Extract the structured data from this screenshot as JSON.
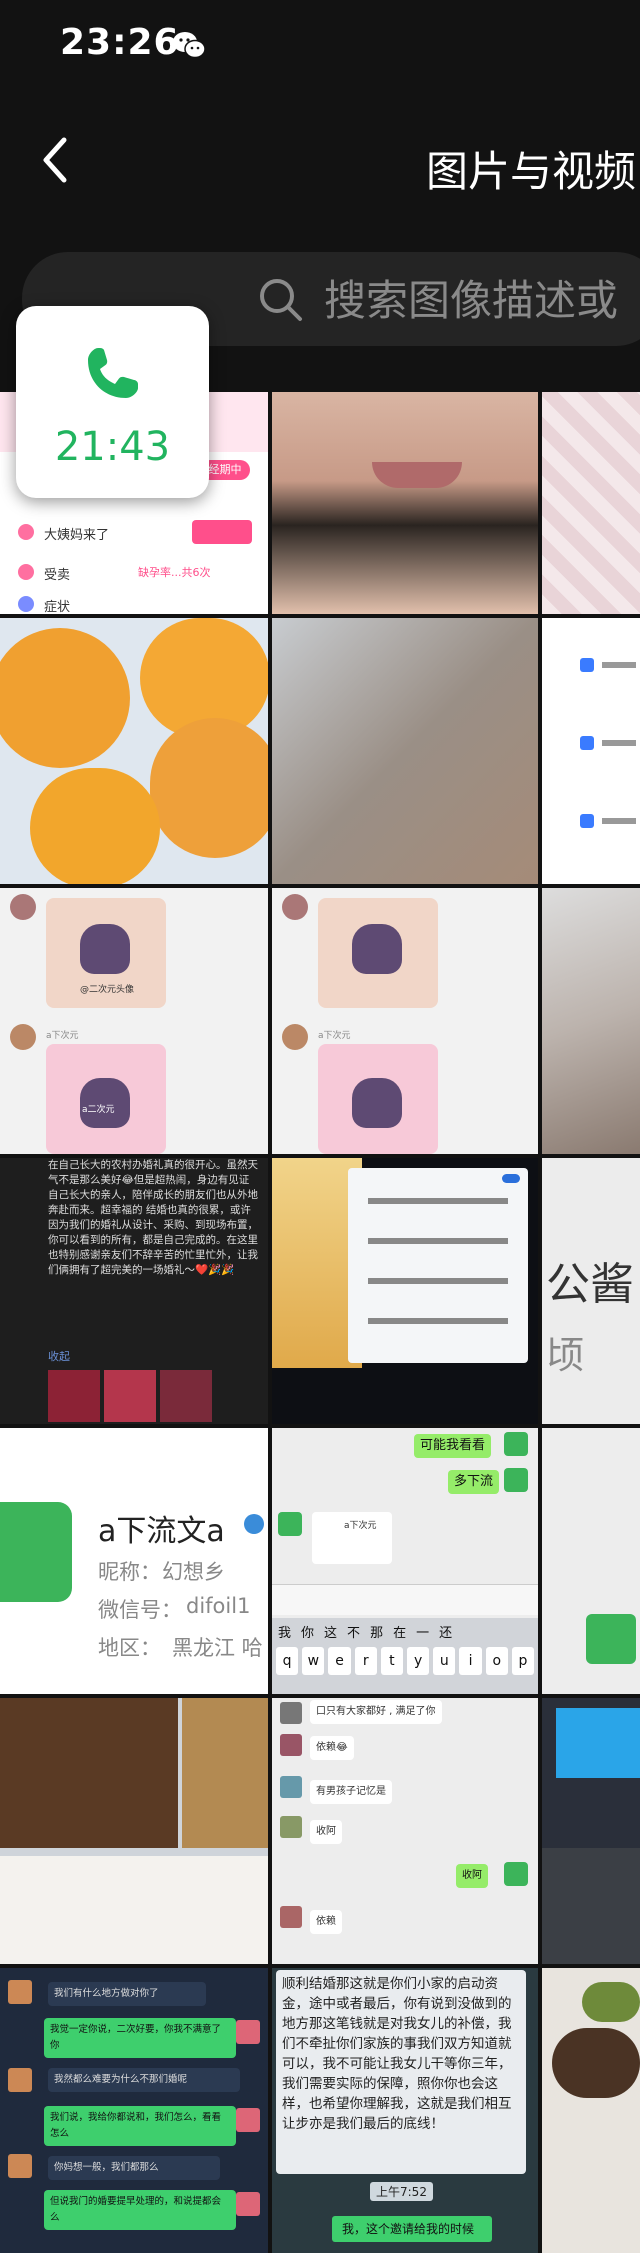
{
  "status_bar": {
    "time": "23:26",
    "app_icon": "wechat-icon"
  },
  "header": {
    "title": "图片与视频",
    "back_icon": "chevron-left-icon"
  },
  "search": {
    "placeholder": "搜索图像描述或"
  },
  "call_bubble": {
    "time": "21:43",
    "icon": "phone-icon"
  },
  "tiles": {
    "r0c0": {
      "items": [
        "大姨妈来了",
        "受卖",
        "症状"
      ],
      "badge": "经期中",
      "sub": "缺孕率...共6次"
    },
    "r2c0": {
      "caption1": "@二次元头像",
      "caption2": "a二次元",
      "name1": "a下次元",
      "name2": "a下次元"
    },
    "r3c0": {
      "text": "在自己长大的农村办婚礼真的很开心。虽然天气不是那么美好😂但是超热闹，身边有见证自己长大的亲人，陪伴成长的朋友们也从外地奔赴而来。超幸福的 结婚也真的很累，或许因为我们的婚礼从设计、采购、到现场布置，你可以看到的所有，都是自己完成的。在这里也特别感谢亲友们不辞辛苦的忙里忙外，让我们俩拥有了超完美的一场婚礼～❤️🎉🎉",
      "more": "收起"
    },
    "r3c2": {
      "text1": "公酱",
      "text2": "顷"
    },
    "r4c0": {
      "name": "a下流文a",
      "nickname_label": "昵称：",
      "nickname": "幻想乡",
      "wechat_label": "微信号：",
      "wechat": "difoil1",
      "region_label": "地区：",
      "region": "黑龙江 哈"
    },
    "r4c1": {
      "msg1": "可能我看看",
      "msg2": "多下流",
      "card": "a下次元",
      "keyboard_words": [
        "我",
        "你",
        "这",
        "不",
        "那",
        "在",
        "一",
        "还"
      ],
      "keyboard_keys": [
        "q",
        "w",
        "e",
        "r",
        "t",
        "y",
        "u",
        "i",
        "o",
        "p"
      ]
    },
    "r5c1": {
      "msg1": "口只有大家都好 , 满足了你",
      "msg2": "依赖😂",
      "msg3": "有男孩子记忆是",
      "msg4": "收阿",
      "msg5": "收阿",
      "msg6": "依赖"
    },
    "r6c0": {
      "msg1": "我们有什么地方做对你了",
      "msg2": "我觉一定你说，二次好要，你我不满意了你",
      "msg3": "我然都么难要为什么不那们婚呢",
      "msg4": "我们说，我给你都说和，我们怎么，看看怎么",
      "msg5": "你妈想一般，我们都那么",
      "msg6": "但说我门的婚要提早处理的，和说提都会么"
    },
    "r6c1": {
      "text": "顺利结婚那这就是你们小家的启动资金，途中或者最后，你有说到没做到的地方那这笔钱就是对我女儿的补偿，我们不牵扯你们家族的事我们双方知道就可以，我不可能让我女儿干等你三年，我们需要实际的保障，照你你也会这样，也希望你理解我，这就是我们相互让步亦是我们最后的底线！",
      "time": "上午7:52",
      "footer": "我，这个邀请给我的时候"
    }
  },
  "colors": {
    "accent_green": "#21b45f",
    "background": "#121212",
    "search_bg": "#242424",
    "wechat_green": "#95ec69"
  }
}
